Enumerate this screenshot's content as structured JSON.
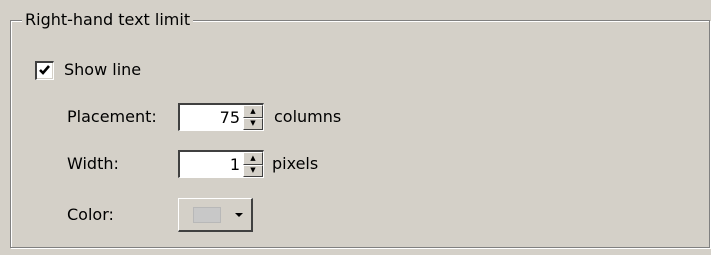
{
  "groupbox": {
    "title": "Right-hand text limit"
  },
  "show_line": {
    "label": "Show line",
    "checked": true
  },
  "placement": {
    "label": "Placement:",
    "value": "75",
    "unit": "columns"
  },
  "width": {
    "label": "Width:",
    "value": "1",
    "unit": "pixels"
  },
  "color": {
    "label": "Color:",
    "swatch": "#c8c8c8"
  },
  "icons": {
    "checkmark": "checkmark-icon",
    "spin_up": "spin-up-icon",
    "spin_down": "spin-down-icon",
    "dropdown": "dropdown-arrow-icon"
  }
}
